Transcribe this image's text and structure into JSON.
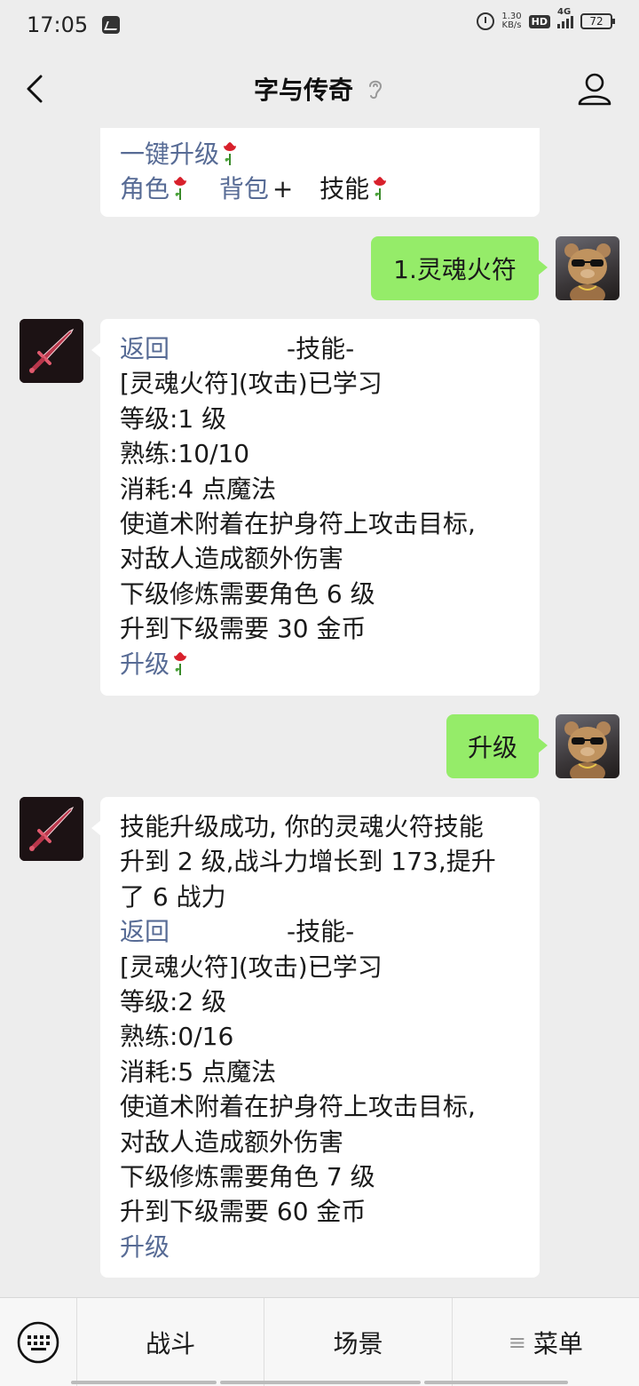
{
  "status_bar": {
    "time": "17:05",
    "net_speed_value": "1.30",
    "net_speed_unit": "KB/s",
    "hd_label": "HD",
    "network_label": "4G",
    "battery": "72"
  },
  "header": {
    "title": "字与传奇"
  },
  "messages": {
    "m1": {
      "line_partial": "一键升级",
      "role": "角色",
      "bag": "背包",
      "bag_suffix": "+",
      "skill": "技能"
    },
    "m2": {
      "text": "1.灵魂火符"
    },
    "m3": {
      "back": "返回",
      "title": "-技能-",
      "lines": [
        "[灵魂火符](攻击)已学习",
        "等级:1 级",
        "熟练:10/10",
        "消耗:4 点魔法",
        "使道术附着在护身符上攻击目标,",
        "对敌人造成额外伤害",
        "下级修炼需要角色 6 级",
        "升到下级需要 30 金币"
      ],
      "upgrade": "升级"
    },
    "m4": {
      "text": "升级"
    },
    "m5": {
      "intro": [
        "技能升级成功, 你的灵魂火符技能",
        "升到 2 级,战斗力增长到 173,提升",
        "了 6 战力"
      ],
      "back": "返回",
      "title": "-技能-",
      "lines": [
        "[灵魂火符](攻击)已学习",
        "等级:2 级",
        "熟练:0/16",
        "消耗:5 点魔法",
        "使道术附着在护身符上攻击目标,",
        "对敌人造成额外伤害",
        "下级修炼需要角色 7 级",
        "升到下级需要 60 金币"
      ],
      "upgrade": "升级"
    }
  },
  "bottom_menu": {
    "battle": "战斗",
    "scene": "场景",
    "menu": "菜单",
    "menu_prefix": "≡"
  },
  "colors": {
    "link": "#576b95",
    "outgoing_bubble": "#95ec69",
    "background": "#ededed"
  },
  "icons": [
    "back-arrow-icon",
    "ear-icon",
    "profile-icon",
    "rose-icon",
    "keyboard-icon",
    "sword-icon"
  ]
}
